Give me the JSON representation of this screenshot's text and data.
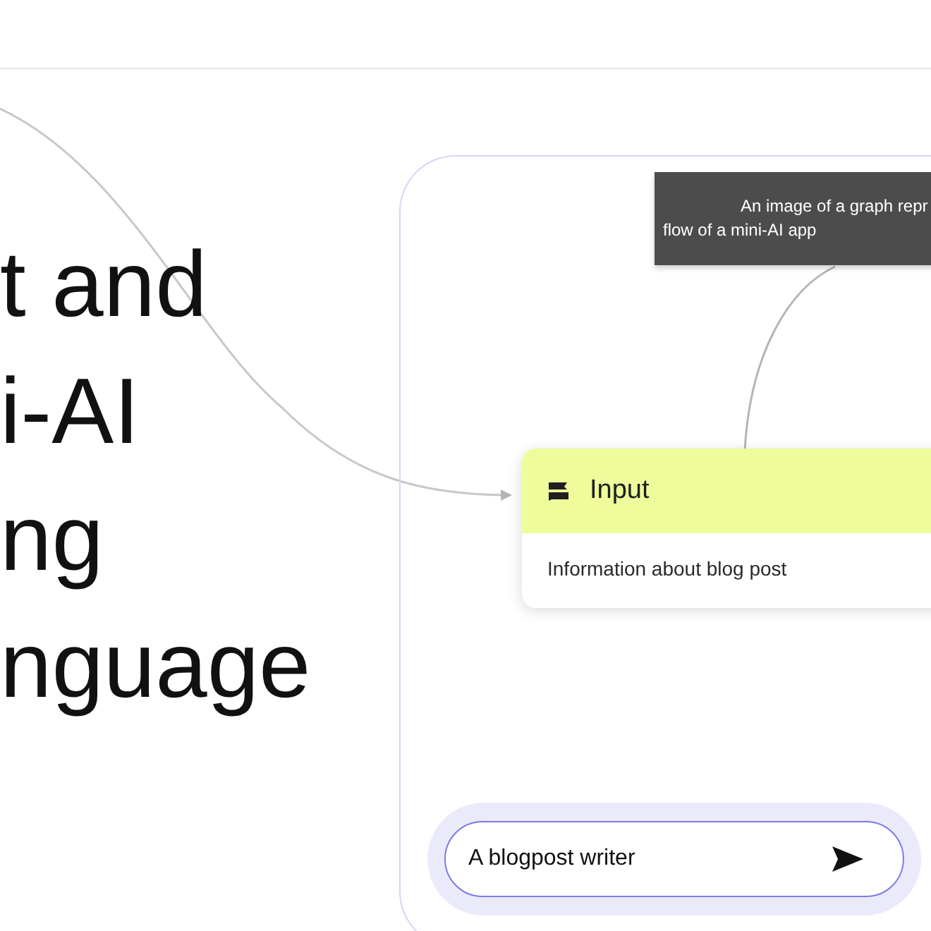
{
  "headline": {
    "lines": [
      "t and",
      "i-AI",
      "ng",
      "nguage"
    ]
  },
  "canvas": {
    "tooltip": {
      "lines": [
        "An image of a graph repr",
        "flow of a mini-AI app"
      ]
    },
    "node": {
      "title": "Input",
      "description": "Information about blog post"
    }
  },
  "prompt": {
    "value": "A blogpost writer"
  }
}
